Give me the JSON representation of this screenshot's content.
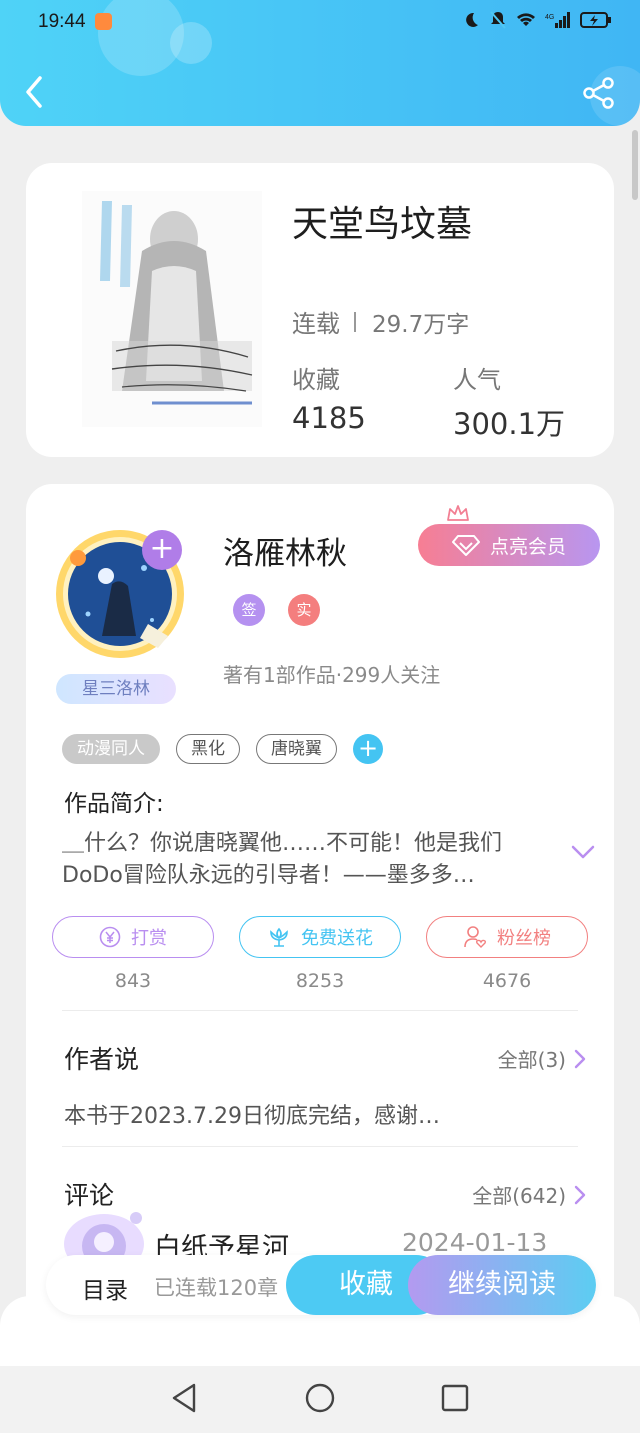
{
  "status_bar": {
    "time": "19:44"
  },
  "book": {
    "title": "天堂鸟坟墓",
    "status": "连载",
    "word_count": "29.7万字",
    "favorites_label": "收藏",
    "favorites_value": "4185",
    "popularity_label": "人气",
    "popularity_value": "300.1万"
  },
  "author": {
    "name": "洛雁林秋",
    "vip_label": "点亮会员",
    "badge_sign": "签",
    "badge_real": "实",
    "meta": "著有1部作品·299人关注",
    "level": "星三洛林"
  },
  "tags": [
    "动漫同人",
    "黑化",
    "唐晓翼"
  ],
  "intro": {
    "title": "作品简介:",
    "text": "＿什么？你说唐晓翼他……不可能！他是我们DoDo冒险队永远的引导者！——墨多多…"
  },
  "actions": [
    {
      "label": "打赏",
      "count": "843"
    },
    {
      "label": "免费送花",
      "count": "8253"
    },
    {
      "label": "粉丝榜",
      "count": "4676"
    }
  ],
  "author_says": {
    "title": "作者说",
    "more": "全部(3)",
    "text": "本书于2023.7.29日彻底完结，感谢…"
  },
  "comments": {
    "title": "评论",
    "more": "全部(642)",
    "first": {
      "name": "白纸予星河",
      "date": "2024-01-13"
    }
  },
  "bottom_bar": {
    "toc": "目录",
    "chapters": "已连载120章",
    "favorite": "收藏",
    "continue": "继续阅读"
  },
  "colors": {
    "header": "#40b6f4",
    "accent_purple": "#b98ef0",
    "accent_blue": "#44c4f2",
    "accent_red": "#f28080"
  }
}
